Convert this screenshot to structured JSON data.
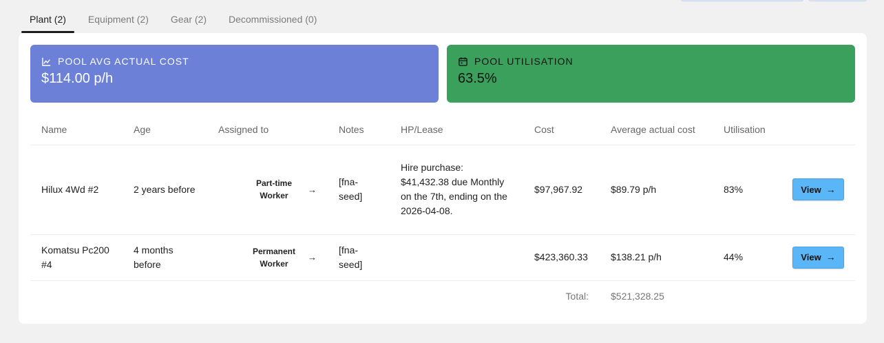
{
  "tabs": [
    {
      "label": "Plant (2)"
    },
    {
      "label": "Equipment (2)"
    },
    {
      "label": "Gear (2)"
    },
    {
      "label": "Decommissioned (0)"
    }
  ],
  "stats": {
    "cost": {
      "title": "POOL AVG ACTUAL COST",
      "value": "$114.00 p/h",
      "icon": "chart-line-icon",
      "color": "#6c80d8"
    },
    "util": {
      "title": "POOL UTILISATION",
      "value": "63.5%",
      "icon": "calendar-icon",
      "color": "#3aa05c"
    }
  },
  "table": {
    "headers": [
      "Name",
      "Age",
      "Assigned to",
      "Notes",
      "HP/Lease",
      "Cost",
      "Average actual cost",
      "Utilisation"
    ],
    "rows": [
      {
        "name": "Hilux 4Wd #2",
        "age": "2 years before",
        "assigned": "Part-time Worker",
        "notes": "[fna-seed]",
        "hp_lease": "Hire purchase: $41,432.38 due Monthly on the 7th, ending on the 2026-04-08.",
        "cost": "$97,967.92",
        "avg_cost": "$89.79 p/h",
        "utilisation": "83%",
        "action": "View"
      },
      {
        "name": "Komatsu Pc200 #4",
        "age": "4 months before",
        "assigned": "Permanent Worker",
        "notes": "[fna-seed]",
        "hp_lease": "",
        "cost": "$423,360.33",
        "avg_cost": "$138.21 p/h",
        "utilisation": "44%",
        "action": "View"
      }
    ],
    "total_label": "Total:",
    "total_value": "$521,328.25"
  }
}
